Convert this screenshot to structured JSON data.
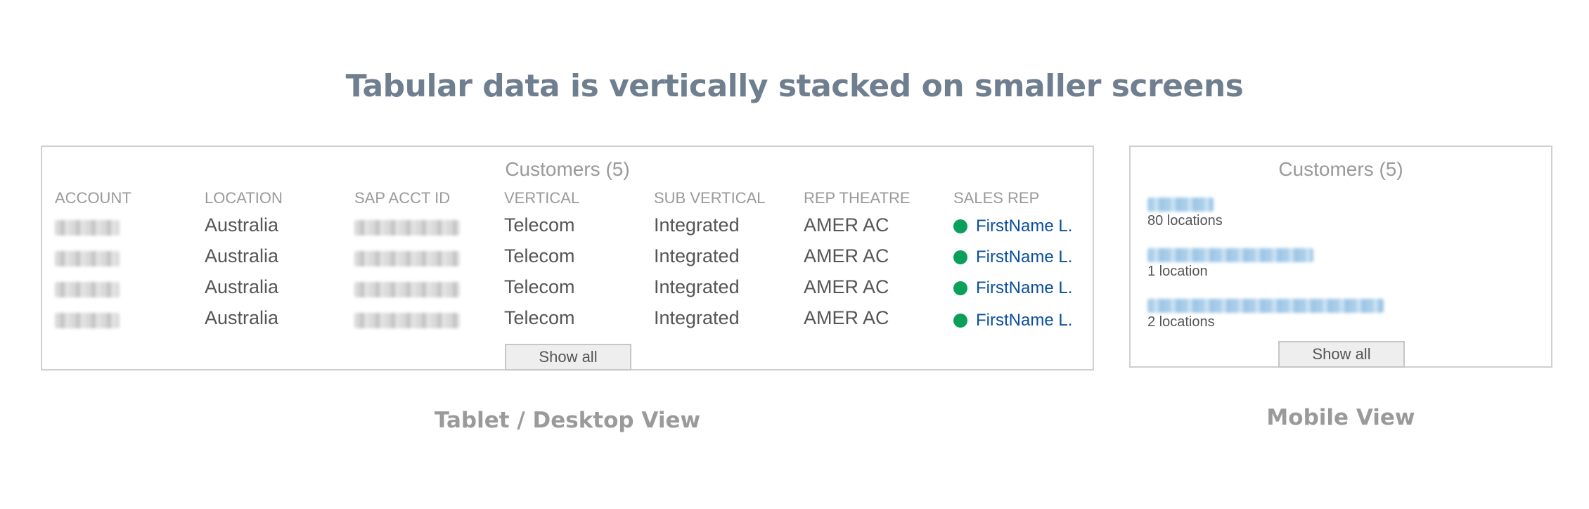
{
  "headline": "Tabular data is vertically stacked on smaller screens",
  "desktop": {
    "title": "Customers (5)",
    "columns": [
      "ACCOUNT",
      "LOCATION",
      "SAP ACCT ID",
      "VERTICAL",
      "SUB VERTICAL",
      "REP THEATRE",
      "SALES REP"
    ],
    "rows": [
      {
        "location": "Australia",
        "vertical": "Telecom",
        "sub_vertical": "Integrated",
        "theatre": "AMER AC",
        "sales_rep": "FirstName L."
      },
      {
        "location": "Australia",
        "vertical": "Telecom",
        "sub_vertical": "Integrated",
        "theatre": "AMER AC",
        "sales_rep": "FirstName L."
      },
      {
        "location": "Australia",
        "vertical": "Telecom",
        "sub_vertical": "Integrated",
        "theatre": "AMER AC",
        "sales_rep": "FirstName L."
      },
      {
        "location": "Australia",
        "vertical": "Telecom",
        "sub_vertical": "Integrated",
        "theatre": "AMER AC",
        "sales_rep": "FirstName L."
      }
    ],
    "show_all": "Show all",
    "caption": "Tablet / Desktop View",
    "status_color": "#0aa05b"
  },
  "mobile": {
    "title": "Customers (5)",
    "items": [
      {
        "locations": "80 locations"
      },
      {
        "locations": "1 location"
      },
      {
        "locations": "2 locations"
      }
    ],
    "show_all": "Show all",
    "caption": "Mobile View"
  }
}
